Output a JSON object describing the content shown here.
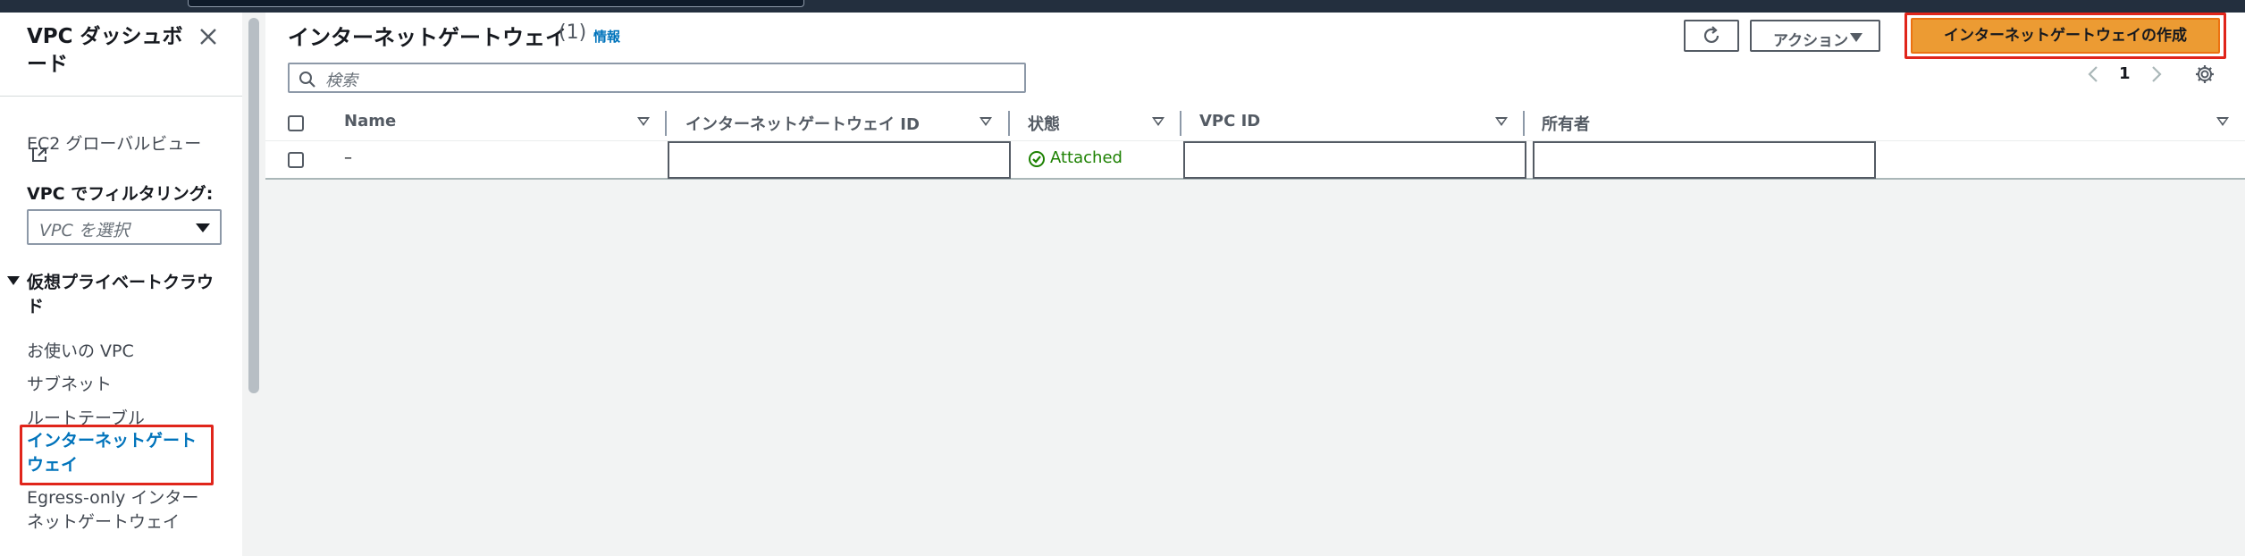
{
  "sidebar": {
    "header": "VPC ダッシュボード",
    "links": {
      "ec2_global": "EC2 グローバルビュー"
    },
    "filter_label": "VPC でフィルタリング:",
    "filter_placeholder": "VPC を選択",
    "section": "仮想プライベートクラウド",
    "items": [
      "お使いの VPC",
      "サブネット",
      "ルートテーブル"
    ],
    "active_item": "インターネットゲートウェイ",
    "egress_item": "Egress-only インターネットゲートウェイ"
  },
  "main": {
    "title": "インターネットゲートウェイ",
    "count": "(1)",
    "info_link": "情報",
    "actions_label": "アクション",
    "create_label": "インターネットゲートウェイの作成",
    "search_placeholder": "検索",
    "page_number": "1"
  },
  "table": {
    "columns": [
      "Name",
      "インターネットゲートウェイ ID",
      "状態",
      "VPC ID",
      "所有者"
    ],
    "rows": [
      {
        "name": "–",
        "id": "",
        "status": "Attached",
        "vpc_id": "",
        "owner": ""
      }
    ]
  },
  "colors": {
    "primary_button": "#ec9b33",
    "highlight_box": "#e0251b",
    "active_link": "#0073bb",
    "status_ok": "#1d8102"
  }
}
